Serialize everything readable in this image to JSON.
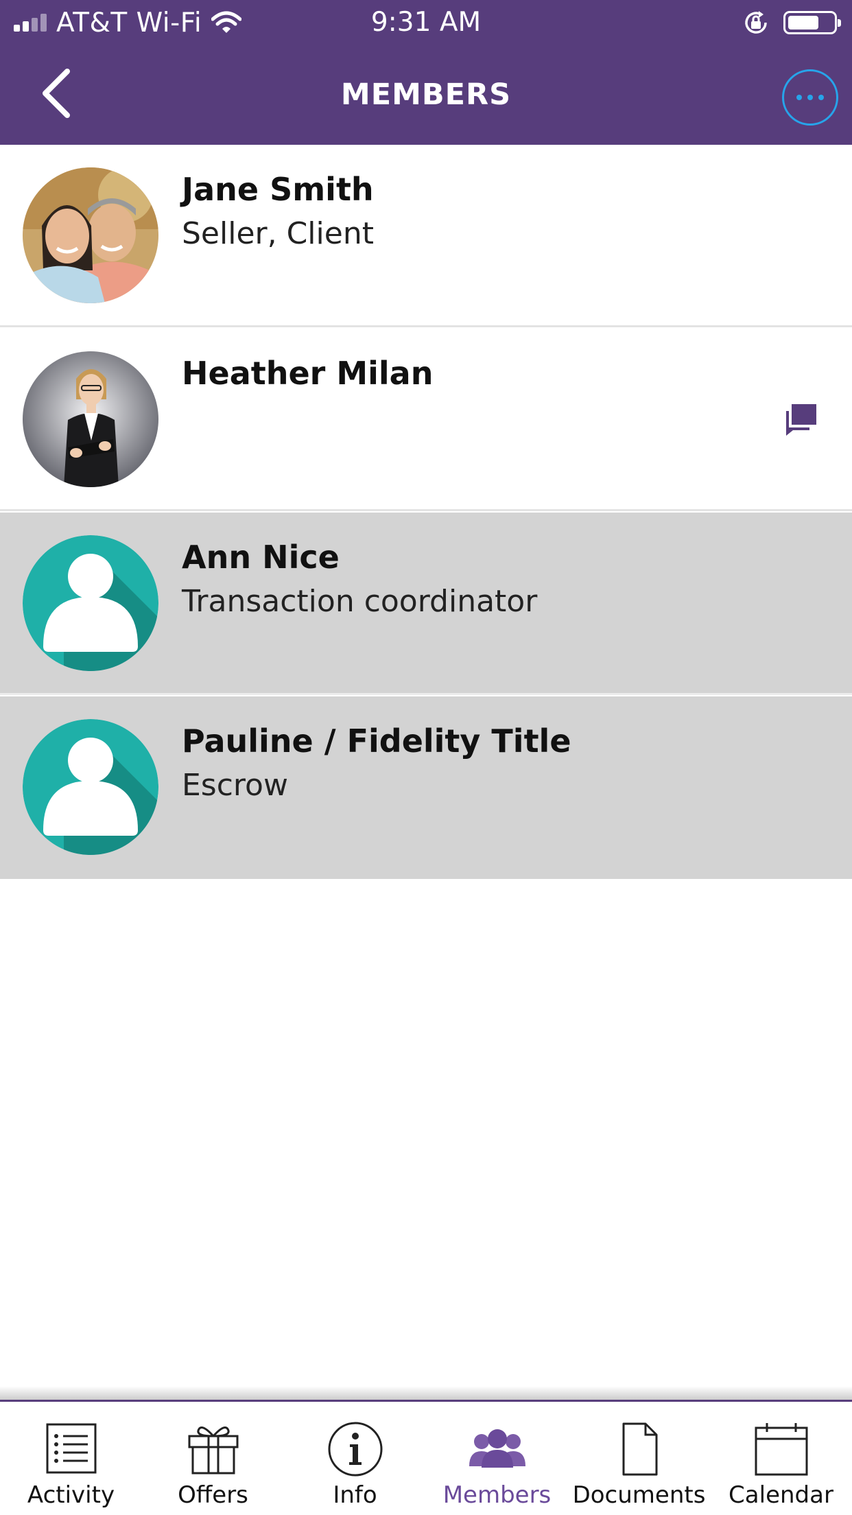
{
  "status_bar": {
    "carrier": "AT&T Wi-Fi",
    "time": "9:31 AM"
  },
  "nav": {
    "title": "MEMBERS"
  },
  "colors": {
    "header": "#573d7c",
    "accent_blue": "#27a4ea",
    "avatar_teal": "#1fb0a8",
    "pending_row": "#d3d3d3",
    "active_tab": "#6a4a9a"
  },
  "members": [
    {
      "name": "Jane Smith",
      "role": "Seller, Client",
      "avatar": "photo-couple",
      "pending": false
    },
    {
      "name": "Heather Milan",
      "role": "",
      "avatar": "photo-businesswoman",
      "pending": false,
      "has_chat": true
    },
    {
      "name": "Ann Nice",
      "role": "Transaction coordinator",
      "avatar": "default-person",
      "pending": true
    },
    {
      "name": "Pauline / Fidelity Title",
      "role": "Escrow",
      "avatar": "default-person",
      "pending": true
    }
  ],
  "tabs": [
    {
      "label": "Activity",
      "icon": "list-icon",
      "active": false
    },
    {
      "label": "Offers",
      "icon": "gift-icon",
      "active": false
    },
    {
      "label": "Info",
      "icon": "info-icon",
      "active": false
    },
    {
      "label": "Members",
      "icon": "members-icon",
      "active": true
    },
    {
      "label": "Documents",
      "icon": "document-icon",
      "active": false
    },
    {
      "label": "Calendar",
      "icon": "calendar-icon",
      "active": false
    }
  ]
}
